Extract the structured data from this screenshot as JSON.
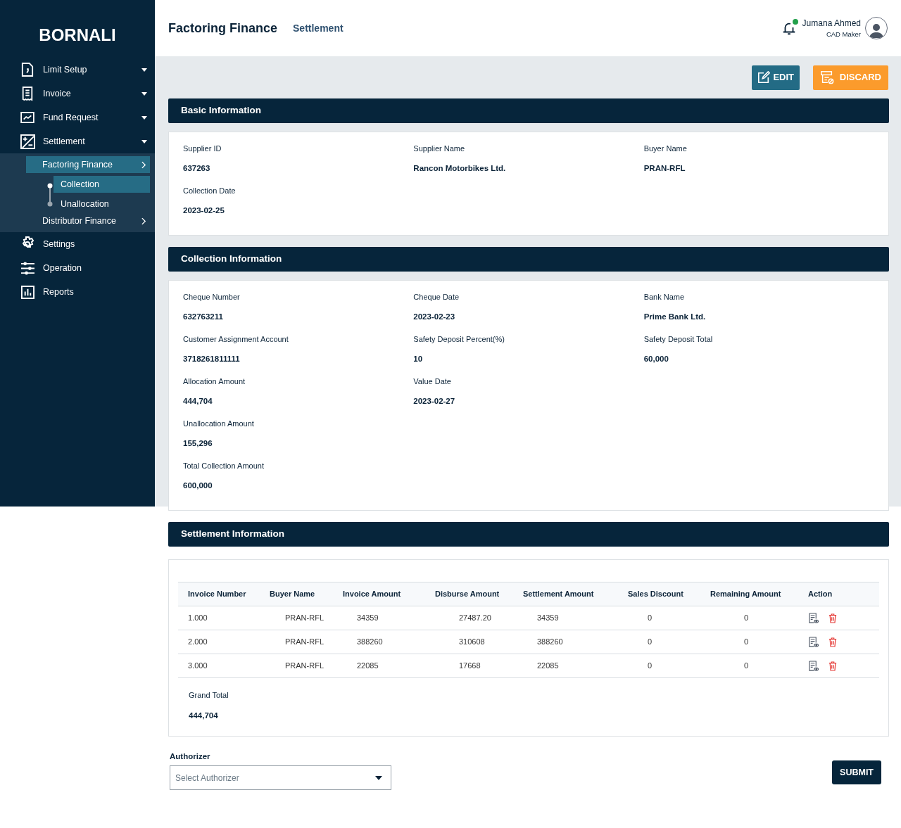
{
  "sidebar": {
    "brand": "BORNALI",
    "items": [
      {
        "label": "Limit Setup",
        "kind": "dropdown"
      },
      {
        "label": "Invoice",
        "kind": "dropdown"
      },
      {
        "label": "Fund Request",
        "kind": "dropdown"
      },
      {
        "label": "Settlement",
        "kind": "dropdown",
        "children": [
          {
            "label": "Factoring Finance",
            "selected": true,
            "children": [
              {
                "label": "Collection",
                "selected": true
              },
              {
                "label": "Unallocation",
                "selected": false
              }
            ]
          },
          {
            "label": "Distributor Finance",
            "selected": false
          }
        ]
      },
      {
        "label": "Settings",
        "kind": "link"
      },
      {
        "label": "Operation",
        "kind": "link"
      },
      {
        "label": "Reports",
        "kind": "link"
      }
    ]
  },
  "header": {
    "title": "Factoring Finance",
    "subtitle": "Settlement",
    "user": {
      "name": "Jumana Ahmed",
      "role": "CAD Maker",
      "notification": true
    }
  },
  "actions": [
    "EDIT",
    "DISCARD"
  ],
  "sections": [
    {
      "title": "Basic Information",
      "rows": [
        [
          {
            "label": "Supplier ID",
            "value": "637263"
          },
          {
            "label": "Supplier Name",
            "value": "Rancon Motorbikes Ltd."
          },
          {
            "label": "Buyer Name",
            "value": "PRAN-RFL"
          }
        ],
        [
          {
            "label": "Collection Date",
            "value": "2023-02-25"
          }
        ]
      ]
    },
    {
      "title": "Collection Information",
      "rows": [
        [
          {
            "label": "Cheque Number",
            "value": "632763211"
          },
          {
            "label": "Cheque Date",
            "value": "2023-02-23"
          },
          {
            "label": "Bank Name",
            "value": "Prime Bank Ltd."
          }
        ],
        [
          {
            "label": "Customer Assignment Account",
            "value": "3718261811111"
          },
          {
            "label": "Safety Deposit Percent(%)",
            "value": "10"
          },
          {
            "label": "Safety Deposit Total",
            "value": "60,000"
          }
        ],
        [
          {
            "label": "Allocation Amount",
            "value": "444,704"
          },
          {
            "label": "Value Date",
            "value": "2023-02-27"
          }
        ],
        [
          {
            "label": "Unallocation Amount",
            "value": "155,296"
          }
        ],
        [
          {
            "label": "Total Collection Amount",
            "value": "600,000"
          }
        ]
      ]
    }
  ],
  "settlement": {
    "title": "Settlement Information",
    "columns": [
      "Invoice Number",
      "Buyer Name",
      "Invoice Amount",
      "Disburse Amount",
      "Settlement Amount",
      "Sales Discount",
      "Remaining Amount",
      "Action"
    ],
    "rows": [
      [
        "1.000",
        "PRAN-RFL",
        "34359",
        "27487.20",
        "34359",
        "0",
        "0"
      ],
      [
        "2.000",
        "PRAN-RFL",
        "388260",
        "310608",
        "388260",
        "0",
        "0"
      ],
      [
        "3.000",
        "PRAN-RFL",
        "22085",
        "17668",
        "22085",
        "0",
        "0"
      ]
    ],
    "grand_total_label": "Grand Total",
    "grand_total": "444,704"
  },
  "authorizer": {
    "label": "Authorizer",
    "placeholder": "Select Authorizer"
  },
  "submit": "SUBMIT"
}
